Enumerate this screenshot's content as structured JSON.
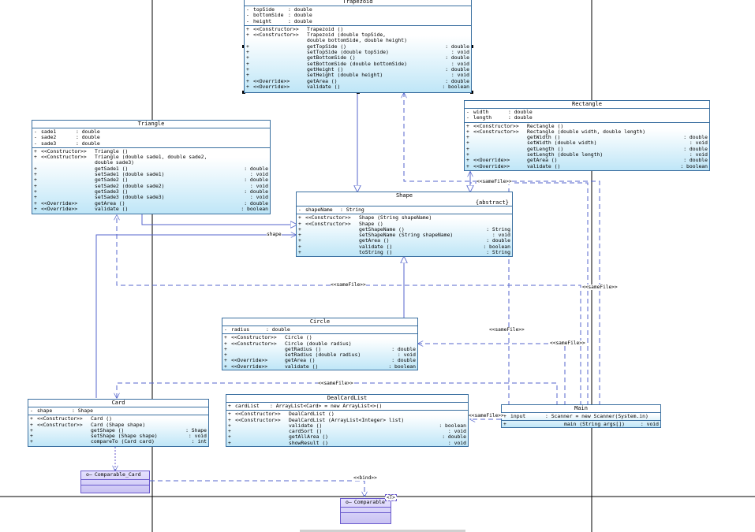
{
  "trapezoid": {
    "title": "Trapezoid",
    "attributes": [
      {
        "v": "-",
        "n": "topSide",
        "t": ": double"
      },
      {
        "v": "-",
        "n": "bottomSide",
        "t": ": double"
      },
      {
        "v": "-",
        "n": "height",
        "t": ": double"
      }
    ],
    "operations": [
      {
        "v": "+",
        "s": "<<Constructor>>",
        "n": "Trapezoid ()",
        "r": ""
      },
      {
        "v": "+",
        "s": "<<Constructor>>",
        "n": "Trapezoid (double topSide,",
        "r": ""
      },
      {
        "v": "",
        "s": "",
        "n": " double bottomSide, double height)",
        "r": ""
      },
      {
        "v": "+",
        "s": "",
        "n": "getTopSide ()",
        "r": ": double"
      },
      {
        "v": "+",
        "s": "",
        "n": "setTopSide (double topSide)",
        "r": ": void"
      },
      {
        "v": "+",
        "s": "",
        "n": "getBottomSide ()",
        "r": ": double"
      },
      {
        "v": "+",
        "s": "",
        "n": "setBottomSide (double bottomSide)",
        "r": ": void"
      },
      {
        "v": "+",
        "s": "",
        "n": "getHeight ()",
        "r": ": double"
      },
      {
        "v": "+",
        "s": "",
        "n": "setHeight (double height)",
        "r": ": void"
      },
      {
        "v": "+",
        "s": "<<Override>>",
        "n": "getArea ()",
        "r": ": double"
      },
      {
        "v": "+",
        "s": "<<Override>>",
        "n": "validate ()",
        "r": ": boolean"
      }
    ]
  },
  "rectangle": {
    "title": "Rectangle",
    "attributes": [
      {
        "v": "-",
        "n": "width",
        "t": ": double"
      },
      {
        "v": "-",
        "n": "length",
        "t": ": double"
      }
    ],
    "operations": [
      {
        "v": "+",
        "s": "<<Constructor>>",
        "n": "Rectangle ()",
        "r": ""
      },
      {
        "v": "+",
        "s": "<<Constructor>>",
        "n": "Rectangle (double width, double length)",
        "r": ""
      },
      {
        "v": "+",
        "s": "",
        "n": "getWidth ()",
        "r": ": double"
      },
      {
        "v": "+",
        "s": "",
        "n": "setWidth (double width)",
        "r": ": void"
      },
      {
        "v": "+",
        "s": "",
        "n": "getLength ()",
        "r": ": double"
      },
      {
        "v": "+",
        "s": "",
        "n": "setLength (double length)",
        "r": ": void"
      },
      {
        "v": "+",
        "s": "<<Override>>",
        "n": "getArea ()",
        "r": ": double"
      },
      {
        "v": "+",
        "s": "<<Override>>",
        "n": "validate ()",
        "r": ": boolean"
      }
    ]
  },
  "triangle": {
    "title": "Triangle",
    "attributes": [
      {
        "v": "-",
        "n": "sade1",
        "t": ": double"
      },
      {
        "v": "-",
        "n": "sade2",
        "t": ": double"
      },
      {
        "v": "-",
        "n": "sade3",
        "t": ": double"
      }
    ],
    "operations": [
      {
        "v": "+",
        "s": "<<Constructor>>",
        "n": "Triangle ()",
        "r": ""
      },
      {
        "v": "+",
        "s": "<<Constructor>>",
        "n": "Triangle (double sade1, double sade2,",
        "r": ""
      },
      {
        "v": "",
        "s": "",
        "n": " double sade3)",
        "r": ""
      },
      {
        "v": "+",
        "s": "",
        "n": "getSade1 ()",
        "r": ": double"
      },
      {
        "v": "+",
        "s": "",
        "n": "setSade1 (double sade1)",
        "r": ": void"
      },
      {
        "v": "+",
        "s": "",
        "n": "getSade2 ()",
        "r": ": double"
      },
      {
        "v": "+",
        "s": "",
        "n": "setSade2 (double sade2)",
        "r": ": void"
      },
      {
        "v": "+",
        "s": "",
        "n": "getSade3 ()",
        "r": ": double"
      },
      {
        "v": "+",
        "s": "",
        "n": "setSade3 (double sade3)",
        "r": ": void"
      },
      {
        "v": "+",
        "s": "<<Override>>",
        "n": "getArea ()",
        "r": ": double"
      },
      {
        "v": "+",
        "s": "<<Override>>",
        "n": "validate ()",
        "r": ": boolean"
      }
    ]
  },
  "shape": {
    "title": "Shape",
    "abstract": "{abstract}",
    "attributes": [
      {
        "v": "-",
        "n": "shapeName",
        "t": ": String"
      }
    ],
    "operations": [
      {
        "v": "+",
        "s": "<<Constructor>>",
        "n": "Shape (String shapeName)",
        "r": ""
      },
      {
        "v": "+",
        "s": "<<Constructor>>",
        "n": "Shape ()",
        "r": ""
      },
      {
        "v": "+",
        "s": "",
        "n": "getShapeName ()",
        "r": ": String"
      },
      {
        "v": "+",
        "s": "",
        "n": "setShapeName (String shapeName)",
        "r": ": void"
      },
      {
        "v": "+",
        "s": "",
        "n": "getArea ()",
        "r": ": double"
      },
      {
        "v": "+",
        "s": "",
        "n": "validate ()",
        "r": ": boolean"
      },
      {
        "v": "+",
        "s": "",
        "n": "toString ()",
        "r": ": String"
      }
    ]
  },
  "circle": {
    "title": "Circle",
    "attributes": [
      {
        "v": "-",
        "n": "radius",
        "t": ": double"
      }
    ],
    "operations": [
      {
        "v": "+",
        "s": "<<Constructor>>",
        "n": "Circle ()",
        "r": ""
      },
      {
        "v": "+",
        "s": "<<Constructor>>",
        "n": "Circle (double radius)",
        "r": ""
      },
      {
        "v": "+",
        "s": "",
        "n": "getRadius ()",
        "r": ": double"
      },
      {
        "v": "+",
        "s": "",
        "n": "setRadius (double radius)",
        "r": ": void"
      },
      {
        "v": "+",
        "s": "<<Override>>",
        "n": "getArea ()",
        "r": ": double"
      },
      {
        "v": "+",
        "s": "<<Override>>",
        "n": "validate ()",
        "r": ": boolean"
      }
    ]
  },
  "card": {
    "title": "Card",
    "attributes": [
      {
        "v": "-",
        "n": "shape",
        "t": ": Shape"
      }
    ],
    "operations": [
      {
        "v": "+",
        "s": "<<Constructor>>",
        "n": "Card ()",
        "r": ""
      },
      {
        "v": "+",
        "s": "<<Constructor>>",
        "n": "Card (Shape shape)",
        "r": ""
      },
      {
        "v": "+",
        "s": "",
        "n": "getShape ()",
        "r": ": Shape"
      },
      {
        "v": "+",
        "s": "",
        "n": "setShape (Shape shape)",
        "r": ": void"
      },
      {
        "v": "+",
        "s": "",
        "n": "compareTo (Card card)",
        "r": ": int"
      }
    ]
  },
  "dealcardlist": {
    "title": "DealCardList",
    "attributes": [
      {
        "v": "+",
        "n": "cardList",
        "t": ": ArrayList<Card>    = new ArrayList<>()"
      }
    ],
    "operations": [
      {
        "v": "+",
        "s": "<<Constructor>>",
        "n": "DealCardList ()",
        "r": ""
      },
      {
        "v": "+",
        "s": "<<Constructor>>",
        "n": "DealCardList (ArrayList<Integer> list)",
        "r": ""
      },
      {
        "v": "+",
        "s": "",
        "n": "validate ()",
        "r": ": boolean"
      },
      {
        "v": "+",
        "s": "",
        "n": "cardSort ()",
        "r": ": void"
      },
      {
        "v": "+",
        "s": "",
        "n": "getAllArea ()",
        "r": ": double"
      },
      {
        "v": "+",
        "s": "",
        "n": "showResult ()",
        "r": ": void"
      }
    ]
  },
  "main": {
    "title": "Main",
    "attributes": [
      {
        "v": "+",
        "n": "input",
        "t": ": Scanner     = new Scanner(System.in)"
      }
    ],
    "operations": [
      {
        "v": "+",
        "s": "",
        "n": "main (String args[])",
        "r": ": void"
      }
    ]
  },
  "comparable_card": {
    "title": "Comparable_Card"
  },
  "comparable": {
    "title": "Comparable",
    "param": "<T>"
  },
  "labels": {
    "shape_assoc": "shape",
    "same_file": "<<sameFile>>",
    "bind": "<<bind>>"
  }
}
